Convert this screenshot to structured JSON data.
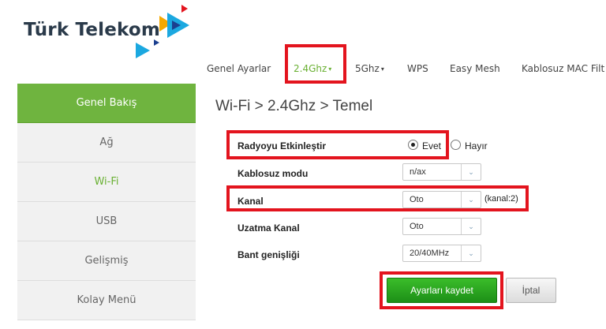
{
  "logo": {
    "text": "Türk Telekom"
  },
  "nav": {
    "items": [
      {
        "label": "Genel Ayarlar"
      },
      {
        "label": "2.4Ghz",
        "caret": "▾"
      },
      {
        "label": "5Ghz",
        "caret": "▾"
      },
      {
        "label": "WPS"
      },
      {
        "label": "Easy Mesh"
      },
      {
        "label": "Kablosuz MAC Filt"
      }
    ]
  },
  "sidebar": {
    "items": [
      {
        "label": "Genel Bakış"
      },
      {
        "label": "Ağ"
      },
      {
        "label": "Wi-Fi"
      },
      {
        "label": "USB"
      },
      {
        "label": "Gelişmiş"
      },
      {
        "label": "Kolay Menü"
      }
    ]
  },
  "main": {
    "title": "Wi-Fi > 2.4Ghz > Temel",
    "radio_row": {
      "label": "Radyoyu Etkinleştir",
      "yes": "Evet",
      "no": "Hayır",
      "selected": "Evet"
    },
    "mode_row": {
      "label": "Kablosuz modu",
      "value": "n/ax"
    },
    "channel_row": {
      "label": "Kanal",
      "value": "Oto",
      "note": "(kanal:2)"
    },
    "ext_channel_row": {
      "label": "Uzatma Kanal",
      "value": "Oto"
    },
    "bandwidth_row": {
      "label": "Bant genişliği",
      "value": "20/40MHz"
    },
    "save_label": "Ayarları kaydet",
    "cancel_label": "İptal"
  },
  "colors": {
    "accent": "#6fb43f",
    "highlight": "#e3141e",
    "save_button": "#2aa520"
  },
  "icons": {
    "select_arrow": "chevron-down-icon"
  }
}
